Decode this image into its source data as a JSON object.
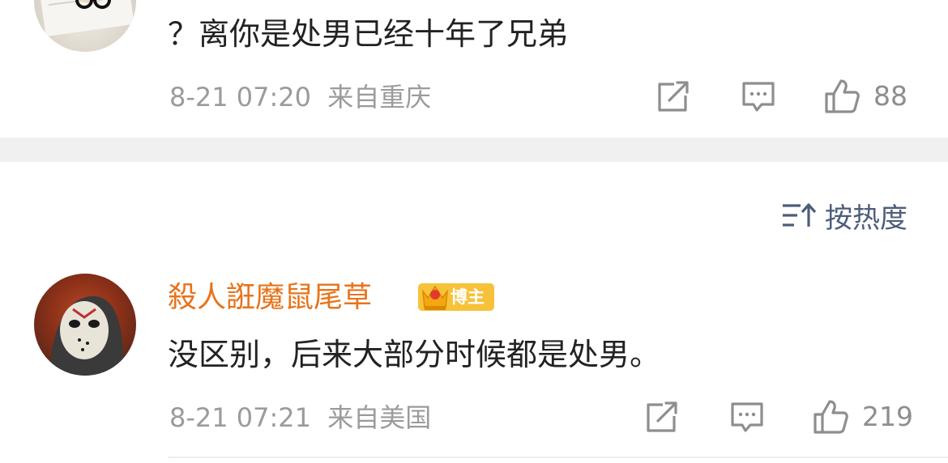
{
  "comments": [
    {
      "text": "？离你是处男已经十年了兄弟",
      "time": "8-21 07:20",
      "location": "来自重庆",
      "likes": "88"
    },
    {
      "username": "殺人誑魔鼠尾草",
      "badge": "博主",
      "text": "没区别，后来大部分时候都是处男。",
      "time": "8-21 07:21",
      "location": "来自美国",
      "likes": "219"
    }
  ],
  "sort": {
    "label": "按热度",
    "icon": "sort-icon"
  },
  "colors": {
    "username": "#e8731a",
    "meta": "#9b9b9b",
    "sort": "#4d5d7a",
    "badge": "#f7c23a",
    "divider": "#f0f0f0"
  }
}
